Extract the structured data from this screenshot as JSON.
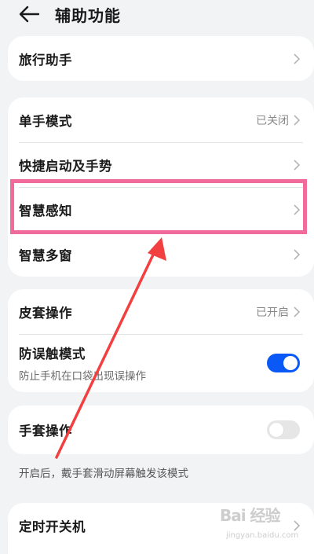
{
  "header": {
    "title": "辅助功能",
    "back_icon": "arrow-left-icon"
  },
  "group1": {
    "items": [
      {
        "label": "旅行助手"
      }
    ]
  },
  "group2": {
    "items": [
      {
        "label": "单手模式",
        "value": "已关闭"
      },
      {
        "label": "快捷启动及手势"
      },
      {
        "label": "智慧感知"
      },
      {
        "label": "智慧多窗"
      }
    ]
  },
  "group3": {
    "items": [
      {
        "label": "皮套操作",
        "value": "已开启"
      },
      {
        "label": "防误触模式",
        "subtitle": "防止手机在口袋出现误操作",
        "toggle_on": true
      }
    ]
  },
  "group4": {
    "items": [
      {
        "label": "手套操作",
        "toggle_on": false
      }
    ],
    "description": "开启后，戴手套滑动屏幕触发该模式"
  },
  "group5": {
    "items": [
      {
        "label": "定时开关机"
      }
    ]
  },
  "watermark": {
    "logo_text": "Bai 经验",
    "url": "jingyan.baidu.com"
  },
  "colors": {
    "accent": "#0a59f7",
    "highlight": "#f06b9b",
    "arrow": "#f24040",
    "background": "#f1f3f5"
  }
}
